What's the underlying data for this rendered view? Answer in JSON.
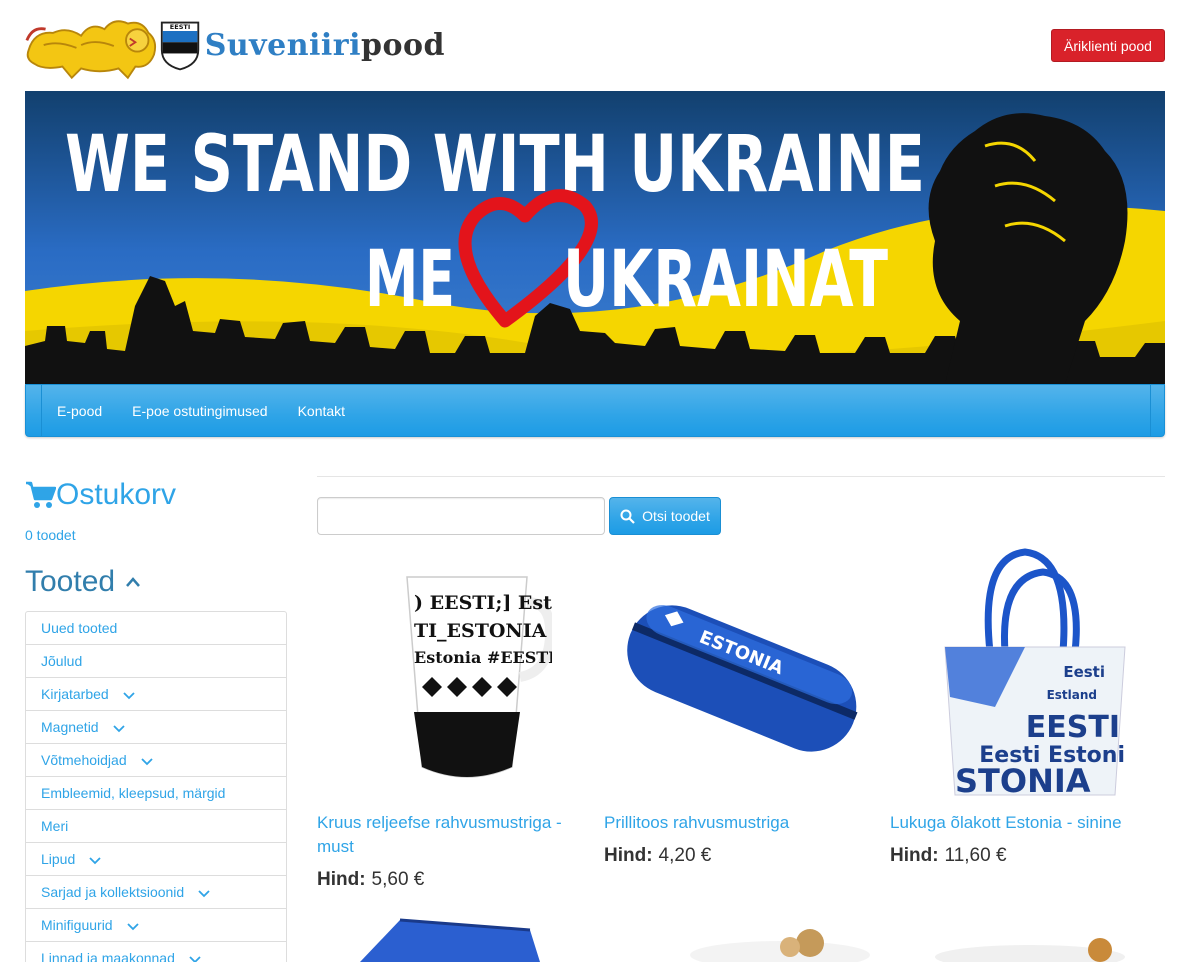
{
  "header": {
    "logo_text_part1": "Suveniiri",
    "logo_text_part2": "pood",
    "logo_shield_text": "EESTI",
    "business_button": "Äriklienti pood"
  },
  "banner": {
    "line1": "WE STAND WITH UKRAINE",
    "line2_left": "ME",
    "line2_right": "UKRAINAT"
  },
  "nav": {
    "items": [
      "E-pood",
      "E-poe ostutingimused",
      "Kontakt"
    ]
  },
  "cart": {
    "title": "Ostukorv",
    "count_text": "0 toodet"
  },
  "products_section": {
    "title": "Tooted"
  },
  "categories": [
    {
      "label": "Uued tooted",
      "expandable": false
    },
    {
      "label": "Jõulud",
      "expandable": false
    },
    {
      "label": "Kirjatarbed",
      "expandable": true
    },
    {
      "label": "Magnetid",
      "expandable": true
    },
    {
      "label": "Võtmehoidjad",
      "expandable": true
    },
    {
      "label": "Embleemid, kleepsud, märgid",
      "expandable": false
    },
    {
      "label": "Meri",
      "expandable": false
    },
    {
      "label": "Lipud",
      "expandable": true
    },
    {
      "label": "Sarjad ja kollektsioonid",
      "expandable": true
    },
    {
      "label": "Minifiguurid",
      "expandable": true
    },
    {
      "label": "Linnad ja maakonnad",
      "expandable": true
    }
  ],
  "search": {
    "placeholder": "",
    "button_label": "Otsi toodet"
  },
  "products": [
    {
      "name": "Kruus reljeefse rahvusmustriga - must",
      "price_label": "Hind:",
      "price": "5,60 €",
      "image": "mug"
    },
    {
      "name": "Prillitoos rahvusmustriga",
      "price_label": "Hind:",
      "price": "4,20 €",
      "image": "glasses-case"
    },
    {
      "name": "Lukuga õlakott Estonia - sinine",
      "price_label": "Hind:",
      "price": "11,60 €",
      "image": "tote-bag"
    }
  ],
  "colors": {
    "accent": "#2fa4e7",
    "brand_red": "#d9222a",
    "ukraine_blue": "#2a6cc4",
    "ukraine_yellow": "#f5d600"
  }
}
